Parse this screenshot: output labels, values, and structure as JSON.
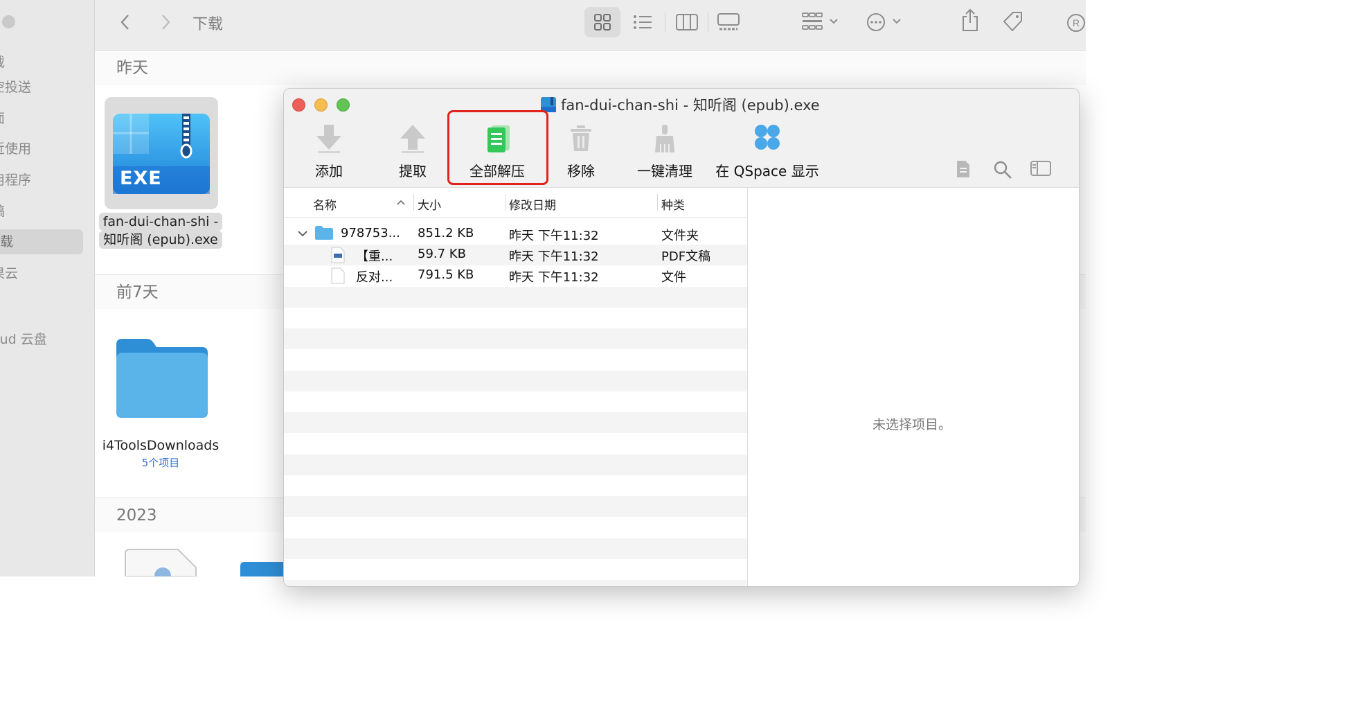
{
  "sidebar": {
    "items": [
      {
        "label": "载"
      },
      {
        "label": "空投送"
      },
      {
        "label": "面"
      },
      {
        "label": "近使用"
      },
      {
        "label": "用程序"
      },
      {
        "label": "稿"
      },
      {
        "label": "载"
      },
      {
        "label": "果云"
      },
      {
        "label": "oud 云盘"
      }
    ],
    "active_index": 6
  },
  "finder_toolbar": {
    "title": "下载",
    "icons": [
      "chevron-left-icon",
      "chevron-right-icon",
      "grid-view-icon",
      "list-view-icon",
      "column-view-icon",
      "gallery-view-icon",
      "group-icon",
      "more-icon",
      "share-icon",
      "tag-icon"
    ]
  },
  "finder": {
    "groups": [
      {
        "label": "昨天"
      },
      {
        "label": "前7天"
      },
      {
        "label": "2023"
      }
    ],
    "files": [
      {
        "name_line1": "fan-dui-chan-shi -",
        "name_line2": "知听阁 (epub).exe",
        "badge": "EXE"
      },
      {
        "name_line1": "i4ToolsDownloads",
        "sub": "5个项目"
      }
    ]
  },
  "archive_window": {
    "title": "fan-dui-chan-shi - 知听阁 (epub).exe",
    "tools": [
      {
        "label": "添加"
      },
      {
        "label": "提取"
      },
      {
        "label": "全部解压"
      },
      {
        "label": "移除"
      },
      {
        "label": "一键清理"
      },
      {
        "label": "在 QSpace 显示"
      }
    ],
    "columns": {
      "name": "名称",
      "size": "大小",
      "modified": "修改日期",
      "kind": "种类"
    },
    "rows": [
      {
        "name": "978753...",
        "size": "851.2 KB",
        "modified": "昨天 下午11:32",
        "kind": "文件夹"
      },
      {
        "name": "【重...",
        "size": "59.7 KB",
        "modified": "昨天 下午11:32",
        "kind": "PDF文稿"
      },
      {
        "name": "反对...",
        "size": "791.5 KB",
        "modified": "昨天 下午11:32",
        "kind": "文件"
      }
    ],
    "info_pane": {
      "empty_text": "未选择项目。"
    }
  },
  "colors": {
    "highlight": "#e0231c",
    "folder": "#5ab4ea",
    "extract_green": "#34c759"
  }
}
